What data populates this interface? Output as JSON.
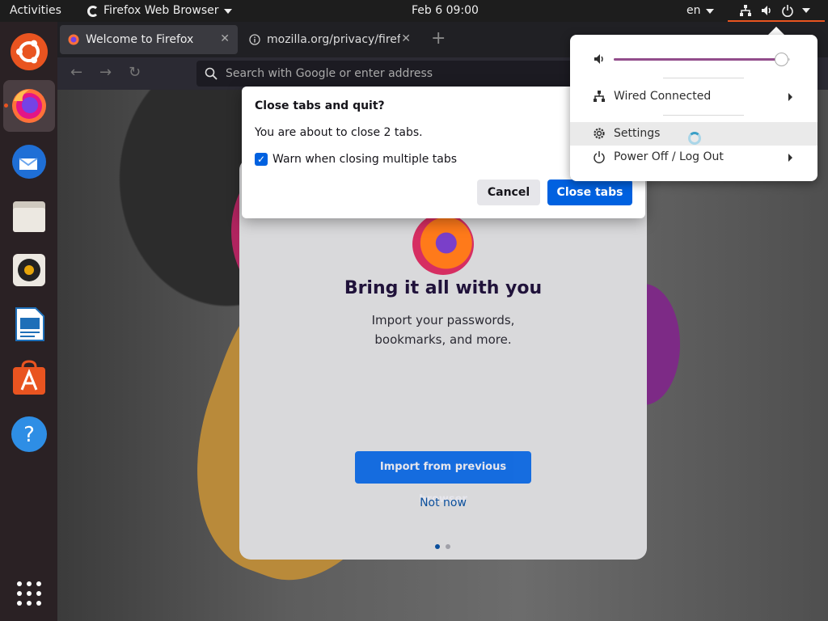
{
  "topbar": {
    "activities": "Activities",
    "app_name": "Firefox Web Browser",
    "clock": "Feb 6  09:00",
    "language": "en",
    "accent_color": "#e95420"
  },
  "dock": {
    "items": [
      {
        "name": "ubuntu-logo",
        "icon": "ubuntu-logo-icon"
      },
      {
        "name": "firefox",
        "icon": "firefox-icon",
        "running": true
      },
      {
        "name": "thunderbird",
        "icon": "thunderbird-icon"
      },
      {
        "name": "files",
        "icon": "files-icon"
      },
      {
        "name": "rhythmbox",
        "icon": "rhythmbox-icon"
      },
      {
        "name": "libreoffice-writer",
        "icon": "writer-icon"
      },
      {
        "name": "ubuntu-software",
        "icon": "software-icon"
      },
      {
        "name": "help",
        "icon": "help-icon"
      },
      {
        "name": "show-applications",
        "icon": "app-grid-icon"
      }
    ]
  },
  "browser": {
    "tabs": [
      {
        "label": "Welcome to Firefox",
        "selected": true
      },
      {
        "label": "mozilla.org/privacy/firefox",
        "selected": false
      }
    ],
    "urlbar_placeholder": "Search with Google or enter address"
  },
  "onboarding": {
    "title": "Bring it all with you",
    "subtitle": "Import your passwords, bookmarks, and more.",
    "import_button": "Import from previous browser",
    "not_now": "Not now"
  },
  "dialog": {
    "title": "Close tabs and quit?",
    "message": "You are about to close 2 tabs.",
    "checkbox_label": "Warn when closing multiple tabs",
    "checkbox_checked": true,
    "cancel_label": "Cancel",
    "confirm_label": "Close tabs"
  },
  "system_menu": {
    "volume_level": 0.95,
    "volume_color": "#924d8b",
    "network_label": "Wired Connected",
    "settings_label": "Settings",
    "power_label": "Power Off / Log Out"
  }
}
